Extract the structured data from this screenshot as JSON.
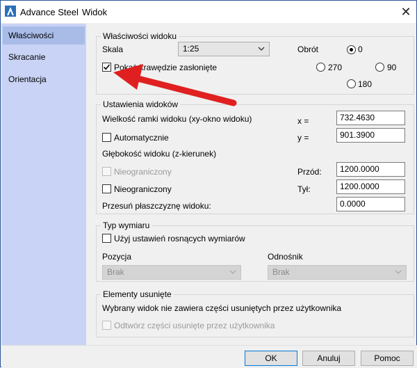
{
  "titlebar": {
    "app_name": "Advance Steel",
    "window_title": "Widok",
    "close": "✕"
  },
  "sidebar": {
    "items": [
      {
        "label": "Właściwości",
        "active": true
      },
      {
        "label": "Skracanie",
        "active": false
      },
      {
        "label": "Orientacja",
        "active": false
      }
    ]
  },
  "props": {
    "title": "Właściwości widoku",
    "scale_label": "Skala",
    "scale_value": "1:25",
    "rotation_label": "Obrót",
    "rotation_options": [
      {
        "label": "0",
        "selected": true
      },
      {
        "label": "270",
        "selected": false
      },
      {
        "label": "90",
        "selected": false
      },
      {
        "label": "180",
        "selected": false
      }
    ],
    "show_hidden_label": "Pokaż krawędzie zasłonięte",
    "show_hidden_checked": true
  },
  "settings": {
    "title": "Ustawienia widoków",
    "frame_label": "Wielkość ramki widoku (xy-okno widoku)",
    "x_label": "x =",
    "x_value": "732.4630",
    "auto_label": "Automatycznie",
    "auto_checked": false,
    "y_label": "y =",
    "y_value": "901.3900",
    "depth_label": "Głębokość widoku (z-kierunek)",
    "unlimited_front_label": "Nieograniczony",
    "unlimited_front_checked": false,
    "front_label": "Przód:",
    "front_value": "1200.0000",
    "unlimited_back_label": "Nieograniczony",
    "unlimited_back_checked": false,
    "back_label": "Tył:",
    "back_value": "1200.0000",
    "shift_label": "Przesuń płaszczyznę widoku:",
    "shift_value": "0.0000"
  },
  "dimension": {
    "title": "Typ wymiaru",
    "incremental_label": "Użyj ustawień rosnących wymiarów",
    "incremental_checked": false,
    "position_label": "Pozycja",
    "position_value": "Brak",
    "reference_label": "Odnośnik",
    "reference_value": "Brak"
  },
  "removed": {
    "title": "Elementy usunięte",
    "info": "Wybrany widok nie zawiera części usuniętych przez użytkownika",
    "restore_label": "Odtwórz części usunięte przez użytkownika",
    "restore_checked": false
  },
  "footer": {
    "ok": "OK",
    "cancel": "Anuluj",
    "help": "Pomoc"
  },
  "colors": {
    "sidebar": "#c9d3f5",
    "sidebar_active": "#a9bce8",
    "arrow": "#e02020",
    "accent": "#0078d7"
  }
}
